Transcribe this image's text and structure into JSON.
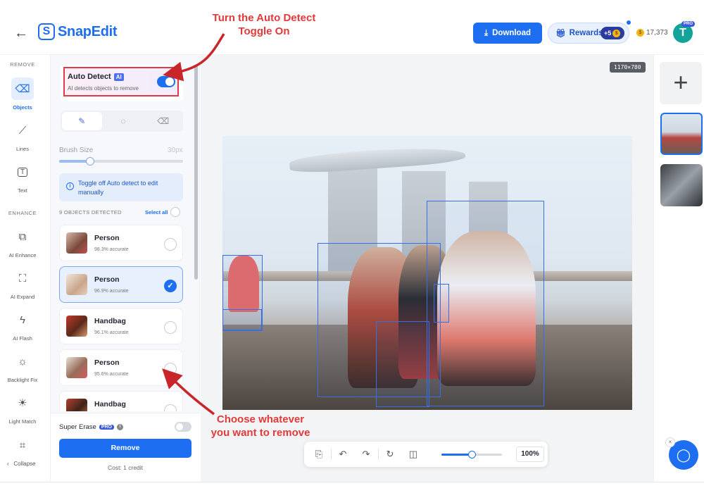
{
  "header": {
    "logo_text": "SnapEdit",
    "download_label": "Download",
    "rewards_label": "Rewards",
    "rewards_bonus": "+5",
    "credits": "17,373",
    "avatar_letter": "T",
    "avatar_badge": "PRO"
  },
  "annotations": {
    "top": "Turn the Auto Detect\nToggle On",
    "bottom": "Choose whatever\nyou want to remove",
    "color": "#e23a3a"
  },
  "rail": {
    "remove_section": "REMOVE",
    "enhance_section": "ENHANCE",
    "tools": [
      {
        "label": "Objects",
        "icon": "eraser-icon",
        "active": true
      },
      {
        "label": "Lines",
        "icon": "line-icon"
      },
      {
        "label": "Text",
        "icon": "text-icon"
      },
      {
        "label": "AI Enhance",
        "icon": "enhance-icon"
      },
      {
        "label": "AI Expand",
        "icon": "expand-icon"
      },
      {
        "label": "AI Flash",
        "icon": "flash-icon"
      },
      {
        "label": "Backlight Fix",
        "icon": "sun-icon"
      },
      {
        "label": "Light Match",
        "icon": "bulb-icon"
      },
      {
        "label": "",
        "icon": "crop-icon"
      }
    ],
    "collapse_label": "Collapse"
  },
  "panel": {
    "auto_detect_title": "Auto Detect",
    "ai_chip": "AI",
    "auto_detect_sub": "AI detects objects to remove",
    "auto_detect_on": true,
    "brush_label": "Brush Size",
    "brush_value": "30px",
    "brush_level": 0.25,
    "info_text": "Toggle off Auto detect to edit manually",
    "detected_label": "9 OBJECTS DETECTED",
    "select_all": "Select all",
    "objects": [
      {
        "name": "Person",
        "accuracy": "98.3% accurate",
        "selected": false
      },
      {
        "name": "Person",
        "accuracy": "96.9% accurate",
        "selected": true
      },
      {
        "name": "Handbag",
        "accuracy": "96.1% accurate",
        "selected": false
      },
      {
        "name": "Person",
        "accuracy": "95.6% accurate",
        "selected": false
      },
      {
        "name": "Handbag",
        "accuracy": "",
        "selected": false
      }
    ],
    "super_erase": "Super Erase",
    "pro_tag": "PRO",
    "info_i": "i",
    "remove_label": "Remove",
    "cost": "Cost: 1 credit"
  },
  "canvas": {
    "dimensions": "1170×780"
  },
  "toolbar": {
    "zoom": "100%",
    "zoom_level": 0.5
  }
}
